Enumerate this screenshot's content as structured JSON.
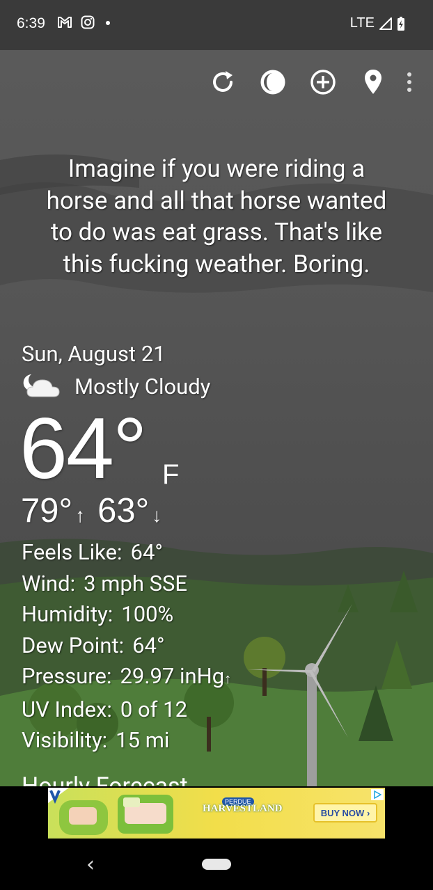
{
  "status_bar": {
    "time": "6:39",
    "icons_left": [
      "gmail-icon",
      "instagram-icon",
      "dot-icon"
    ],
    "network": "LTE",
    "icons_right": [
      "signal-icon",
      "battery-charging-icon"
    ]
  },
  "toolbar": {
    "buttons": [
      "refresh-icon",
      "moon-phase-icon",
      "add-location-icon",
      "location-pin-icon",
      "more-options-icon"
    ]
  },
  "quote": {
    "lines": [
      "Imagine if you were riding a",
      "horse and all that horse wanted",
      "to do was eat grass. That's like",
      "this fucking weather. Boring."
    ]
  },
  "current": {
    "date": "Sun, August 21",
    "condition": "Mostly Cloudy",
    "condition_icon": "night-cloudy-icon",
    "temperature": "64°",
    "unit": "F",
    "high": "79°",
    "low": "63°",
    "high_arrow": "↑",
    "low_arrow": "↓"
  },
  "details": [
    {
      "label": "Feels Like:",
      "value": "64°",
      "suffix": ""
    },
    {
      "label": "Wind:",
      "value": "3 mph SSE",
      "suffix": ""
    },
    {
      "label": "Humidity:",
      "value": "100%",
      "suffix": ""
    },
    {
      "label": "Dew Point:",
      "value": "64°",
      "suffix": ""
    },
    {
      "label": "Pressure:",
      "value": "29.97 inHg",
      "suffix": "↑"
    },
    {
      "label": "UV Index:",
      "value": "0 of 12",
      "suffix": ""
    },
    {
      "label": "Visibility:",
      "value": "15 mi",
      "suffix": ""
    }
  ],
  "hourly_peek": "Hourly Forecast",
  "ad": {
    "brand_top": "PERDUE",
    "brand": "HARVESTLAND",
    "cta": "BUY NOW",
    "colors": {
      "background": "#e8df4f",
      "cta_text": "#2b4ea2"
    }
  },
  "nav": {
    "back": "‹"
  }
}
